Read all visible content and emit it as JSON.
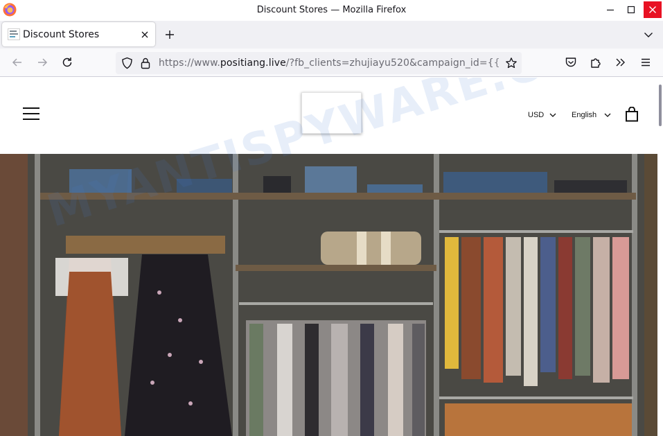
{
  "window": {
    "title": "Discount Stores — Mozilla Firefox"
  },
  "tabs": [
    {
      "label": "Discount Stores",
      "active": true
    }
  ],
  "navbar": {
    "url_prefix": "https://www.",
    "url_host": "positiang.live",
    "url_path": "/?fb_clients=zhujiayu520&campaign_id={{"
  },
  "site": {
    "currency": "USD",
    "language": "English"
  },
  "watermark": {
    "text": "MYANTISPYWARE.COM"
  },
  "colors": {
    "close_button": "#e81123",
    "tab_strip": "#f0f0f4",
    "url_bar": "#f0f0f4"
  },
  "icons": {
    "browser": "firefox-logo-icon",
    "menu": "hamburger-menu-icon",
    "cart": "shopping-bag-icon"
  }
}
